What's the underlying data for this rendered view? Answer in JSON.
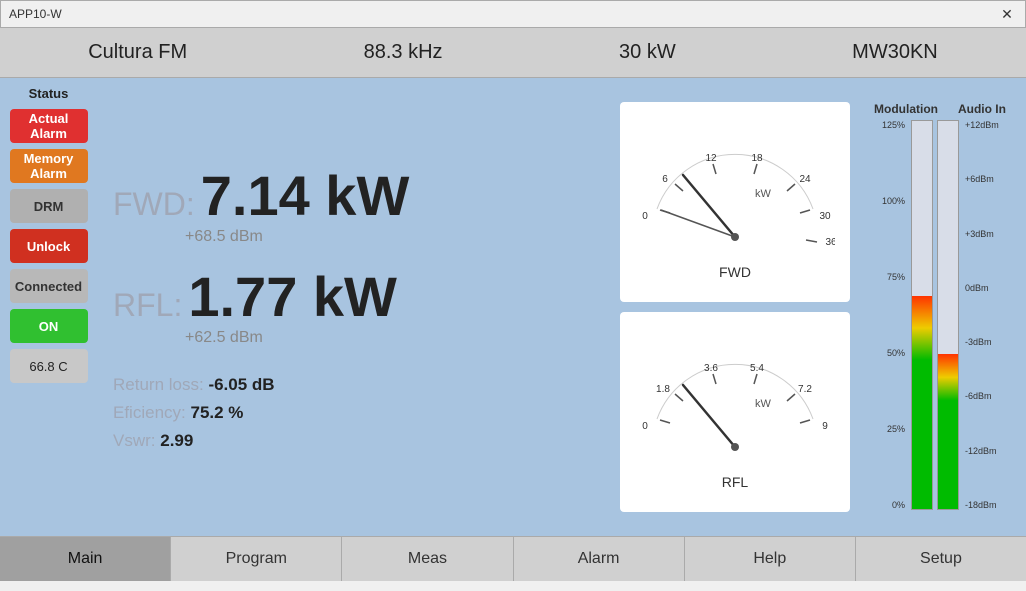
{
  "titlebar": {
    "title": "APP10-W",
    "close_label": "✕"
  },
  "header": {
    "station": "Cultura FM",
    "frequency": "88.3 kHz",
    "power": "30 kW",
    "model": "MW30KN"
  },
  "sidebar": {
    "status_label": "Status",
    "buttons": [
      {
        "id": "actual-alarm",
        "label": "Actual Alarm",
        "style": "btn-red"
      },
      {
        "id": "memory-alarm",
        "label": "Memory Alarm",
        "style": "btn-orange"
      },
      {
        "id": "drm",
        "label": "DRM",
        "style": "btn-gray"
      },
      {
        "id": "unlock",
        "label": "Unlock",
        "style": "btn-red2"
      },
      {
        "id": "connected",
        "label": "Connected",
        "style": "btn-gray2"
      },
      {
        "id": "on",
        "label": "ON",
        "style": "btn-green"
      }
    ],
    "temp": "66.8  C"
  },
  "measurements": {
    "fwd_label": "FWD:",
    "fwd_value": "7.14 kW",
    "fwd_sub": "+68.5 dBm",
    "rfl_label": "RFL:",
    "rfl_value": "1.77 kW",
    "rfl_sub": "+62.5 dBm",
    "return_loss_label": "Return loss:",
    "return_loss_value": "-6.05 dB",
    "efficiency_label": "Eficiency:",
    "efficiency_value": "75.2 %",
    "vswr_label": "Vswr:",
    "vswr_value": "2.99"
  },
  "gauges": {
    "fwd_label": "FWD",
    "rfl_label": "RFL",
    "fwd_unit": "kW",
    "rfl_unit": "kW",
    "fwd_ticks": [
      "0",
      "6",
      "12",
      "18",
      "24",
      "30",
      "36"
    ],
    "rfl_ticks": [
      "0",
      "1.8",
      "3.6",
      "5.4",
      "7.2",
      "9"
    ]
  },
  "meters": {
    "modulation_title": "Modulation",
    "audio_title": "Audio In",
    "scale_left": [
      "125%",
      "100%",
      "75%",
      "50%",
      "25%",
      "0%"
    ],
    "scale_right": [
      "+12dBm",
      "+6dBm",
      "+3dBm",
      "0dBm",
      "-3dBm",
      "-6dBm",
      "-12dBm",
      "-18dBm"
    ],
    "mod_fill_pct": 55,
    "audio_fill_pct": 40
  },
  "tabs": [
    {
      "id": "main",
      "label": "Main",
      "active": true
    },
    {
      "id": "program",
      "label": "Program",
      "active": false
    },
    {
      "id": "meas",
      "label": "Meas",
      "active": false
    },
    {
      "id": "alarm",
      "label": "Alarm",
      "active": false
    },
    {
      "id": "help",
      "label": "Help",
      "active": false
    },
    {
      "id": "setup",
      "label": "Setup",
      "active": false
    }
  ]
}
